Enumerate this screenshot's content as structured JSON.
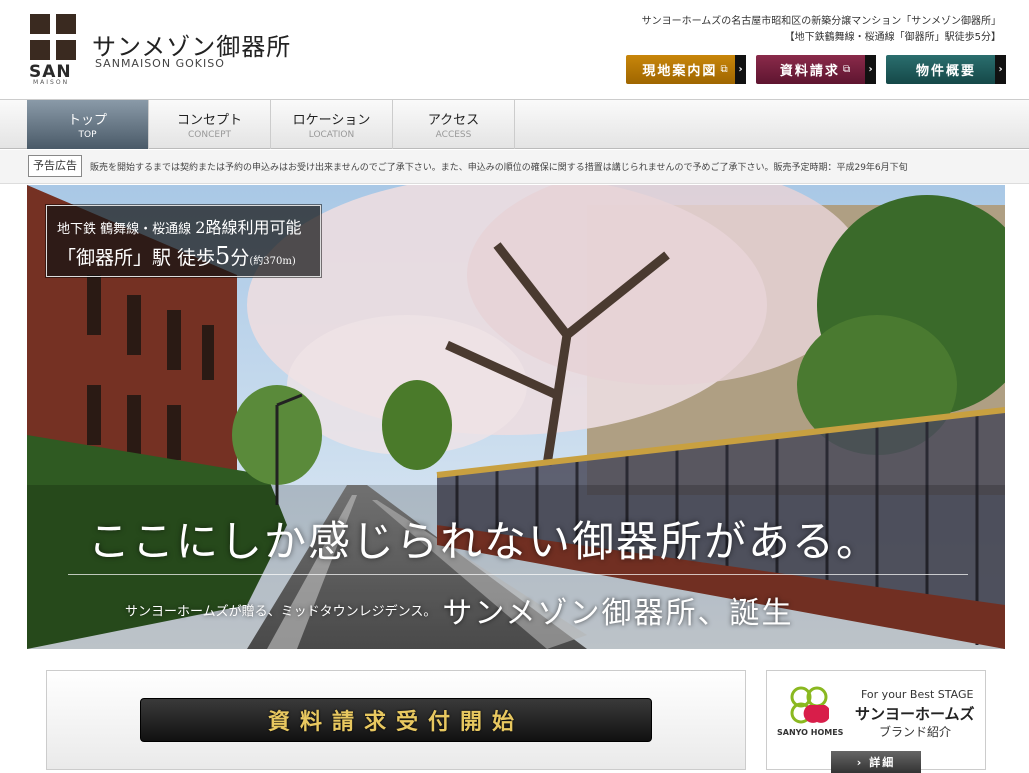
{
  "header": {
    "logo_text": "SAN",
    "logo_subtext": "MAISON",
    "brand_jp": "サンメゾン御器所",
    "brand_en": "SANMAISON GOKISO",
    "tagline_1": "サンヨーホームズの名古屋市昭和区の新築分譲マンション「サンメゾン御器所」",
    "tagline_2": "【地下鉄鶴舞線・桜通線「御器所」駅徒歩5分】",
    "buttons": {
      "map": "現地案内図",
      "request": "資料請求",
      "overview": "物件概要",
      "arrow": "›",
      "window_icon": "⧉"
    }
  },
  "nav": {
    "items": [
      {
        "jp": "トップ",
        "en": "TOP"
      },
      {
        "jp": "コンセプト",
        "en": "CONCEPT"
      },
      {
        "jp": "ロケーション",
        "en": "LOCATION"
      },
      {
        "jp": "アクセス",
        "en": "ACCESS"
      }
    ]
  },
  "notice": {
    "tag": "予告広告",
    "text": "販売を開始するまでは契約または予約の申込みはお受け出来ませんのでご了承下さい。また、申込みの順位の確保に関する措置は講じられませんので予めご了承下さい。販売予定時期：平成29年6月下旬"
  },
  "hero": {
    "station_line1_a": "地下鉄 鶴舞線・桜通線",
    "station_line1_b": "2路線利用可能",
    "station_line2_a": "「御器所」駅 徒歩",
    "station_line2_min": "5",
    "station_line2_b": "分",
    "station_line2_c": "(約370m)",
    "copy_main": "ここにしか感じられない御器所がある。",
    "copy_sub_small": "サンヨーホームズが贈る、ミッドタウンレジデンス。",
    "copy_sub_big": "サンメゾン御器所、誕生"
  },
  "request_banner": "資料請求受付開始",
  "sanyo": {
    "logo_name": "SANYO HOMES",
    "line1": "For your Best STAGE",
    "line2": "サンヨーホームズ",
    "line3": "ブランド紹介",
    "detail": "詳細",
    "detail_arrow": "›"
  },
  "colors": {
    "map_btn": "#b07a06",
    "request_btn": "#7a2040",
    "overview_btn": "#206060",
    "banner_text": "#e8c860"
  }
}
